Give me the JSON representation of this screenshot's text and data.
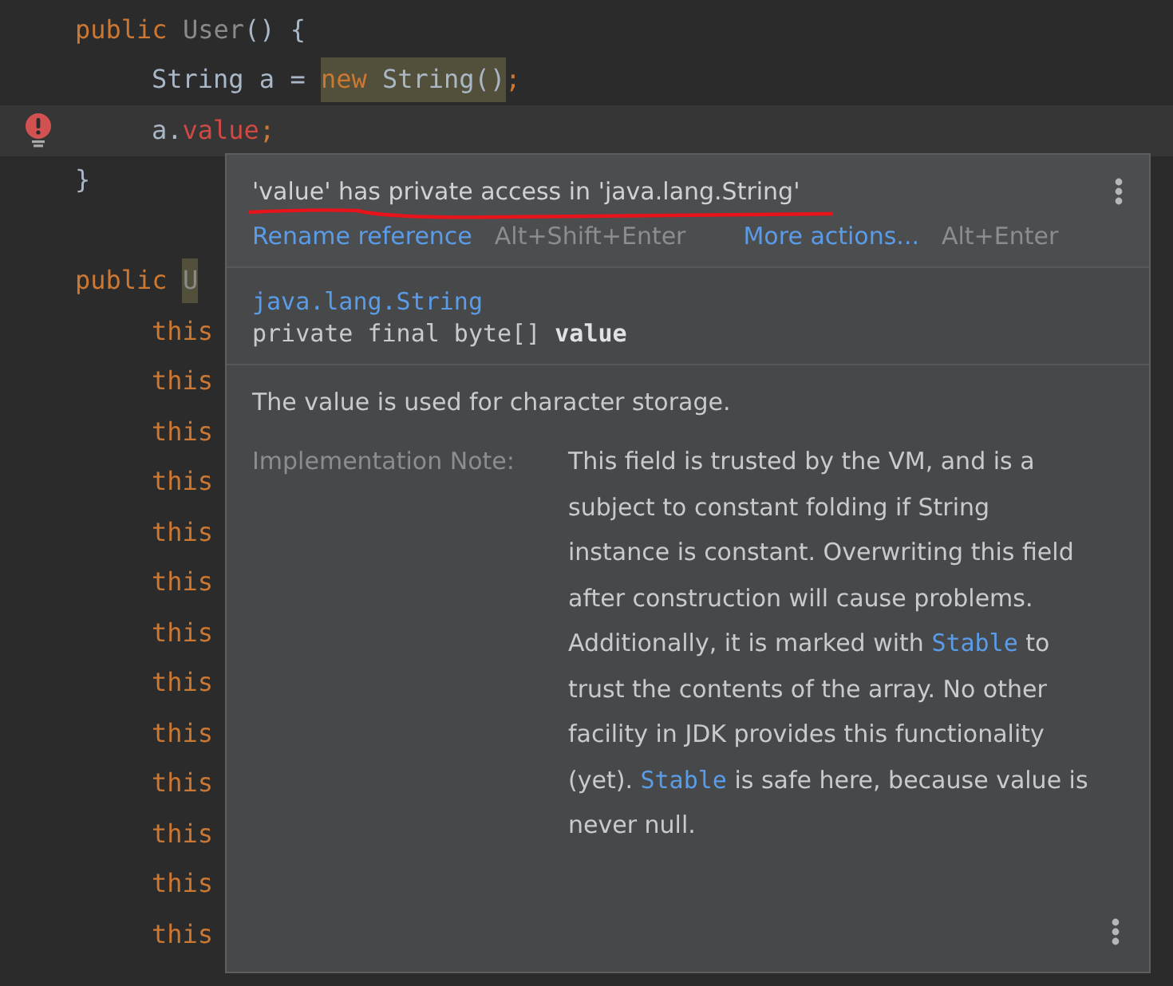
{
  "editor": {
    "lines": [
      {
        "kind": "code",
        "error": false,
        "tokens": [
          {
            "kind": "keyword",
            "text": "public "
          },
          {
            "kind": "unused",
            "text": "User"
          },
          {
            "kind": "plain",
            "text": "() {"
          }
        ],
        "children": [
          {
            "kind": "code",
            "error": false,
            "tokens": [
              {
                "kind": "plain",
                "text": "String a = "
              },
              {
                "kind": "keyword",
                "text": "new",
                "highlight": true
              },
              {
                "kind": "plain",
                "text": " String()",
                "highlight": true
              },
              {
                "kind": "keyword",
                "text": ";"
              }
            ]
          },
          {
            "kind": "code",
            "error": true,
            "tokens": [
              {
                "kind": "plain",
                "text": "a."
              },
              {
                "kind": "error",
                "text": "value"
              },
              {
                "kind": "keyword",
                "text": ";"
              }
            ]
          }
        ]
      },
      {
        "kind": "code",
        "error": false,
        "tokens": [
          {
            "kind": "plain",
            "text": "}"
          }
        ]
      },
      {
        "kind": "blank"
      },
      {
        "kind": "code",
        "error": false,
        "tokens": [
          {
            "kind": "keyword",
            "text": "public "
          },
          {
            "kind": "unused",
            "text": "U",
            "highlight": true
          }
        ],
        "children": [
          {
            "kind": "code",
            "error": false,
            "tokens": [
              {
                "kind": "keyword",
                "text": "this"
              }
            ]
          },
          {
            "kind": "code",
            "error": false,
            "tokens": [
              {
                "kind": "keyword",
                "text": "this"
              }
            ]
          },
          {
            "kind": "code",
            "error": false,
            "tokens": [
              {
                "kind": "keyword",
                "text": "this"
              }
            ]
          },
          {
            "kind": "code",
            "error": false,
            "tokens": [
              {
                "kind": "keyword",
                "text": "this"
              }
            ]
          },
          {
            "kind": "code",
            "error": false,
            "tokens": [
              {
                "kind": "keyword",
                "text": "this"
              }
            ]
          },
          {
            "kind": "code",
            "error": false,
            "tokens": [
              {
                "kind": "keyword",
                "text": "this"
              }
            ]
          },
          {
            "kind": "code",
            "error": false,
            "tokens": [
              {
                "kind": "keyword",
                "text": "this"
              }
            ]
          },
          {
            "kind": "code",
            "error": false,
            "tokens": [
              {
                "kind": "keyword",
                "text": "this"
              }
            ]
          },
          {
            "kind": "code",
            "error": false,
            "tokens": [
              {
                "kind": "keyword",
                "text": "this"
              }
            ]
          },
          {
            "kind": "code",
            "error": false,
            "tokens": [
              {
                "kind": "keyword",
                "text": "this"
              }
            ]
          },
          {
            "kind": "code",
            "error": false,
            "tokens": [
              {
                "kind": "keyword",
                "text": "this"
              }
            ]
          },
          {
            "kind": "code",
            "error": false,
            "tokens": [
              {
                "kind": "keyword",
                "text": "this"
              }
            ]
          },
          {
            "kind": "code",
            "error": false,
            "tokens": [
              {
                "kind": "keyword",
                "text": "this"
              }
            ]
          }
        ]
      }
    ]
  },
  "popup": {
    "error_message": "'value' has private access in 'java.lang.String'",
    "actions": [
      {
        "label": "Rename reference",
        "shortcut": "Alt+Shift+Enter"
      },
      {
        "label": "More actions...",
        "shortcut": "Alt+Enter"
      }
    ],
    "declaration": {
      "container": "java.lang.String",
      "signature": "private final byte[] ",
      "name": "value"
    },
    "description": "The value is used for character storage.",
    "note": {
      "label": "Implementation Note:",
      "segments": [
        {
          "kind": "text",
          "text": "This field is trusted by the VM, and is a subject to constant folding if String instance is constant. Overwriting this field after construction will cause problems. Additionally, it is marked with "
        },
        {
          "kind": "link",
          "text": "Stable"
        },
        {
          "kind": "text",
          "text": " to trust the contents of the array. No other facility in JDK provides this functionality (yet). "
        },
        {
          "kind": "link",
          "text": "Stable"
        },
        {
          "kind": "text",
          "text": " is safe here, because value is never null."
        }
      ]
    }
  }
}
